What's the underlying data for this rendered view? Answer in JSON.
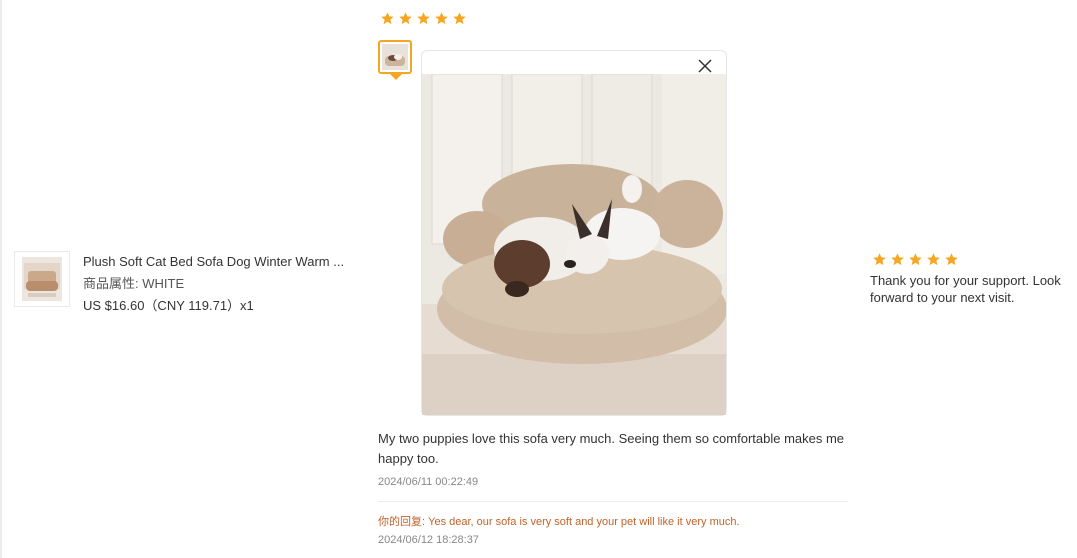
{
  "product": {
    "title": "Plush Soft Cat Bed Sofa Dog Winter Warm ...",
    "attribute_label": "商品属性:",
    "attribute_value": "WHITE",
    "price": "US $16.60（CNY  119.71）x1"
  },
  "review": {
    "rating": 5,
    "text": "My two puppies love this sofa very much. Seeing them so comfortable makes me happy too.",
    "date": "2024/06/11 00:22:49",
    "reply_label": "你的回复:",
    "reply_text": "Yes dear, our sofa is very soft and your pet will like it very much.",
    "reply_date": "2024/06/12 18:28:37"
  },
  "seller_review": {
    "rating": 5,
    "text": "Thank you for your support. Look forward to your next visit."
  },
  "icons": {
    "star": "star-icon",
    "close": "close-icon"
  },
  "colors": {
    "star": "#f5a623",
    "reply": "#c0632a",
    "thumb_border": "#f5a623"
  }
}
